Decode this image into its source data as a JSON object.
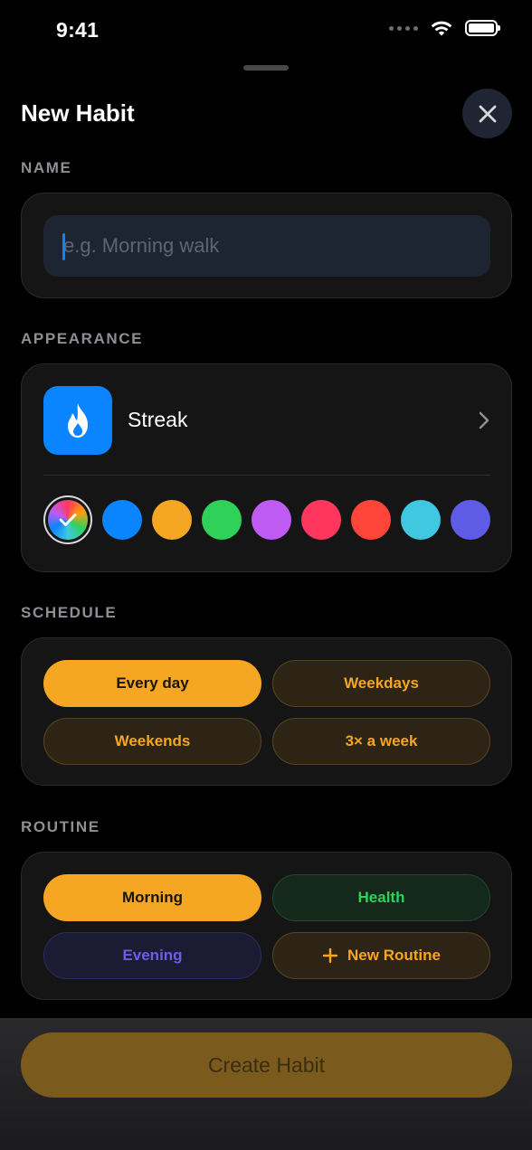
{
  "status": {
    "time": "9:41"
  },
  "sheet": {
    "title": "New Habit"
  },
  "name_section": {
    "label": "NAME",
    "placeholder": "e.g. Morning walk",
    "value": ""
  },
  "appearance": {
    "label": "APPEARANCE",
    "icon": "flame-icon",
    "icon_name": "Streak",
    "accent": "#0a84ff",
    "colors": [
      "multicolor",
      "#0a84ff",
      "#f5a623",
      "#30d158",
      "#bf5af2",
      "#ff375f",
      "#ff453a",
      "#40c8e0",
      "#5e5ce6"
    ],
    "selected_color": "multicolor"
  },
  "schedule": {
    "label": "SCHEDULE",
    "options": [
      {
        "label": "Every day",
        "selected": true
      },
      {
        "label": "Weekdays",
        "selected": false
      },
      {
        "label": "Weekends",
        "selected": false
      },
      {
        "label": "3× a week",
        "selected": false
      }
    ]
  },
  "routine": {
    "label": "ROUTINE",
    "options": [
      {
        "label": "Morning",
        "selected": true,
        "color": "#f5a623"
      },
      {
        "label": "Health",
        "selected": false,
        "color": "#30d158"
      },
      {
        "label": "Evening",
        "selected": false,
        "color": "#5e5ce6"
      },
      {
        "label": "New Routine",
        "selected": false,
        "color": "#f5a623",
        "icon": "plus-icon"
      }
    ]
  },
  "footer": {
    "create_label": "Create Habit",
    "enabled": false
  }
}
